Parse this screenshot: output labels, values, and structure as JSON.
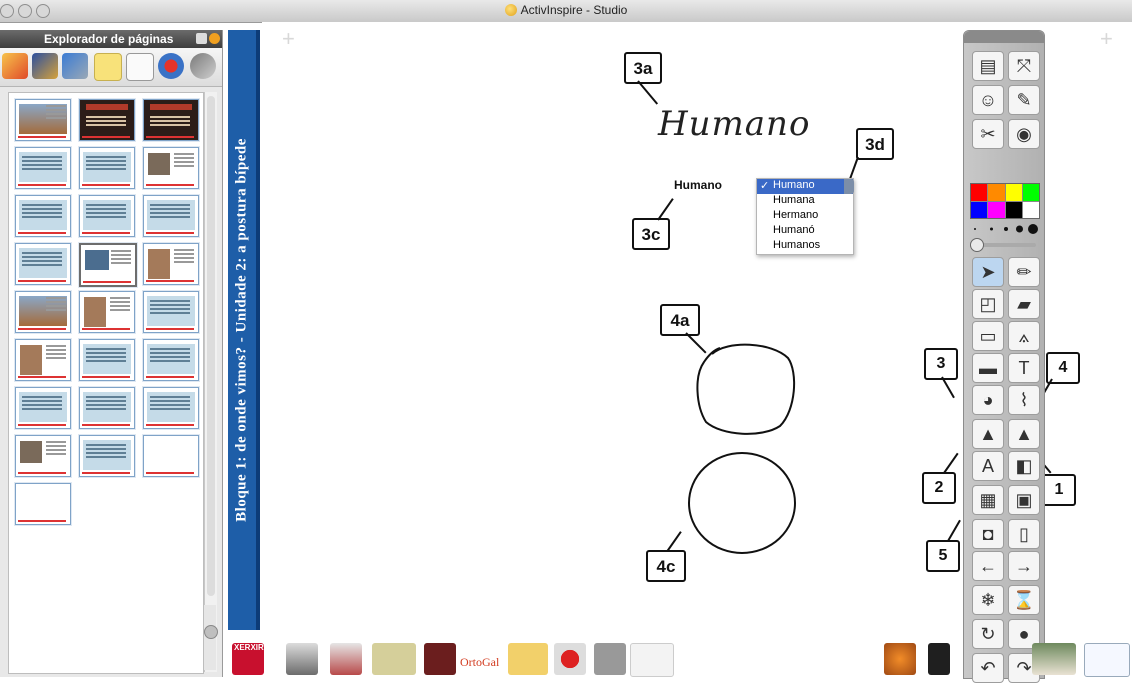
{
  "window": {
    "title": "ActivInspire - Studio"
  },
  "page_browser": {
    "title": "Explorador de páginas",
    "tab_icons": [
      "page-browser-icon",
      "resource-library-icon",
      "object-browser-icon",
      "notes-icon",
      "property-browser-icon",
      "actions-icon",
      "voting-icon"
    ],
    "thumbnails": [
      [
        "photo",
        "dark",
        "dark"
      ],
      [
        "light",
        "light",
        "grey"
      ],
      [
        "light",
        "light",
        "light"
      ],
      [
        "light",
        "selected",
        "brown"
      ],
      [
        "photo",
        "brown",
        "light"
      ],
      [
        "brown",
        "light",
        "light"
      ],
      [
        "light",
        "light",
        "light"
      ],
      [
        "grey",
        "light",
        "blank"
      ],
      [
        "blank"
      ]
    ]
  },
  "banner": {
    "text": "Bloque 1: de onde vimos? - Unidade 2: a postura bípede"
  },
  "canvas": {
    "handwriting": "Humano",
    "converted_text": "Humano",
    "dropdown": {
      "options": [
        "Humano",
        "Humana",
        "Hermano",
        "Humanó",
        "Humanos"
      ],
      "selected_index": 0
    },
    "callouts": {
      "c3a": "3a",
      "c3c": "3c",
      "c3d": "3d",
      "c4a": "4a",
      "c4c": "4c",
      "c1": "1",
      "c2": "2",
      "c3": "3",
      "c4": "4",
      "c5": "5"
    }
  },
  "toolbox": {
    "palette_colors": [
      "#ff0000",
      "#ff8a00",
      "#ffff00",
      "#00ff00",
      "#0000ff",
      "#ff00ff",
      "#000000",
      "#ffffff"
    ],
    "tools": [
      "profile-icon",
      "fullscreen-icon",
      "user-icon",
      "designer-mode-icon",
      "tools-icon",
      "browser-icon",
      "select-icon",
      "pen-icon",
      "shape-icon",
      "highlighter-icon",
      "ruler-icon",
      "compass-icon",
      "eraser-icon",
      "text-icon",
      "fill-icon",
      "magic-ink-icon",
      "shape-recognition-icon",
      "handwriting-recognition-icon",
      "handwriting-to-text-icon",
      "shape-to-object-icon",
      "calculator-icon",
      "camera-icon",
      "spotlight-icon",
      "page-icon",
      "previous-page-icon",
      "next-page-icon",
      "screen-keyboard-icon",
      "hourglass-icon",
      "reset-icon",
      "record-icon",
      "undo-icon",
      "redo-icon"
    ]
  },
  "dock": {
    "labels": [
      "XERXIR",
      "OrtoGal"
    ]
  }
}
